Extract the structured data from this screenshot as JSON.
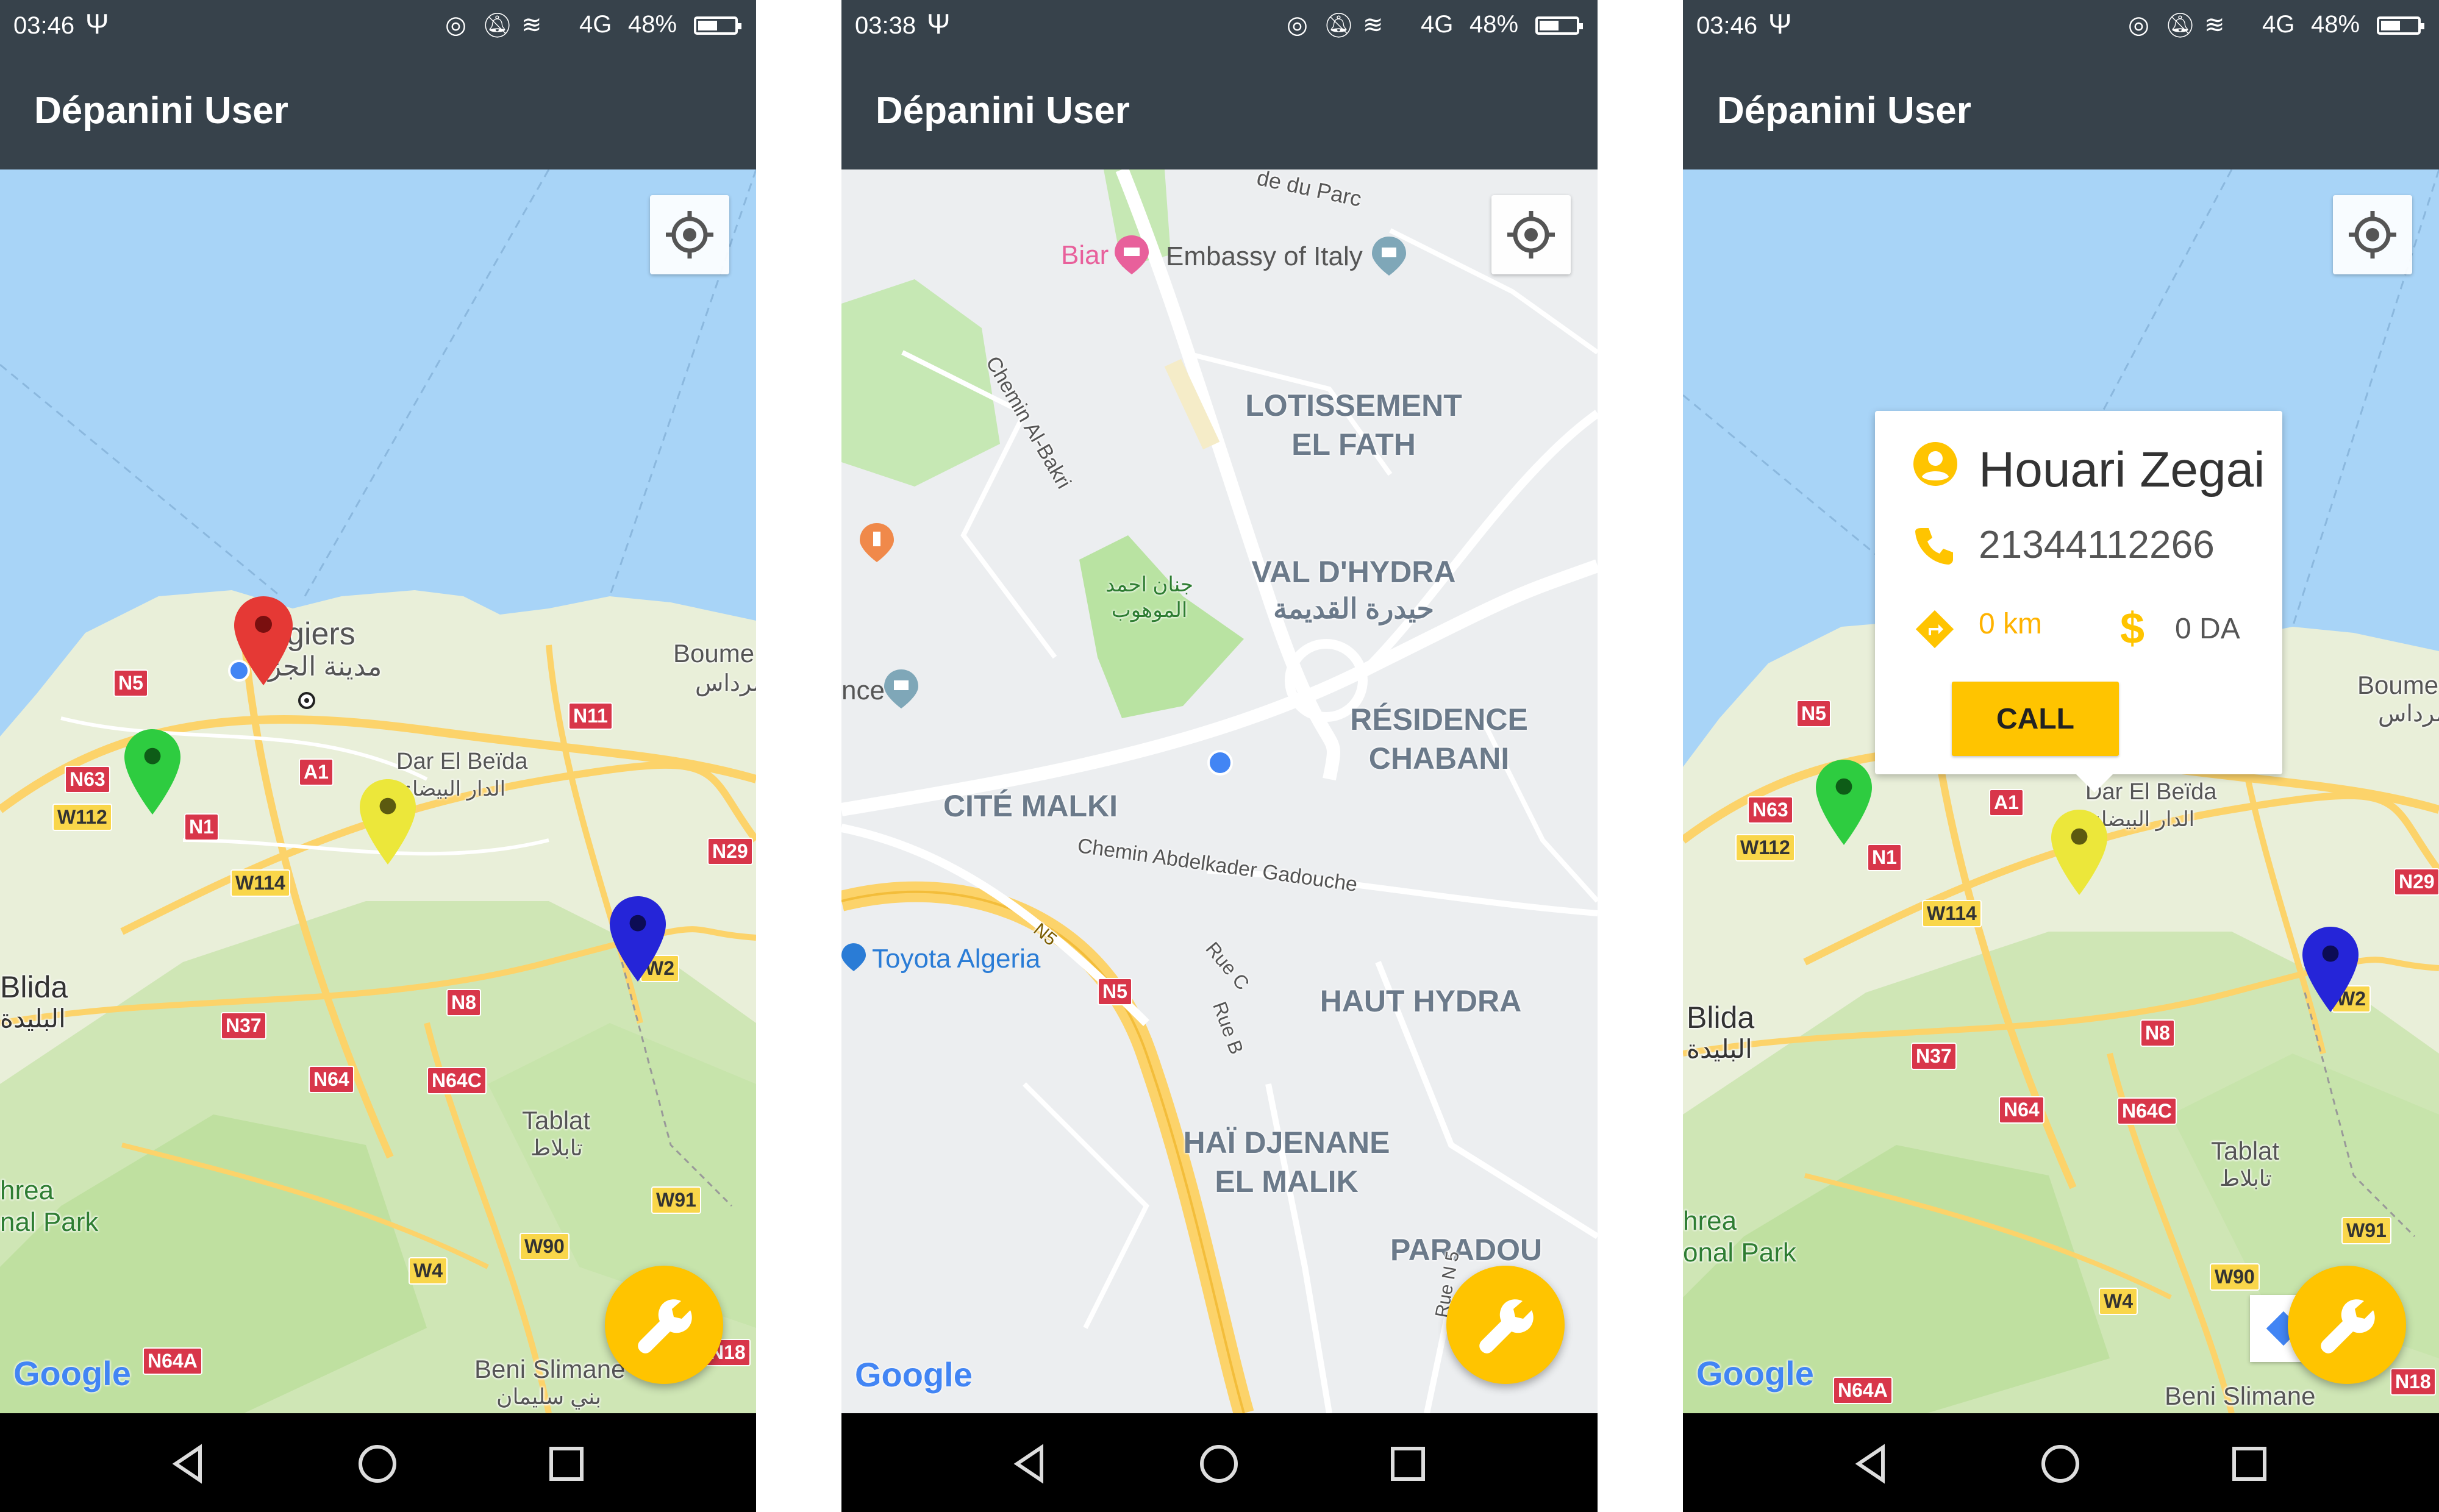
{
  "colors": {
    "appbar": "#37424b",
    "accent": "#ffc400",
    "sea": "#a8d4f7",
    "land": "#e9efd9",
    "park": "#bfe0a0",
    "road_yellow": "#fcd36a",
    "marker_red": "#e53935",
    "marker_green": "#2ecc40",
    "marker_yellow": "#ece73a",
    "marker_blue": "#2525d8"
  },
  "screens": [
    {
      "status": {
        "time": "03:46",
        "network": "4G",
        "battery": "48%"
      },
      "app_title": "Dépanini User",
      "map": {
        "labels": {
          "alger_fr": "giers",
          "alger_ar": "مدينة الجز",
          "boumerdes_fr": "Boume",
          "boumerdes_ar": "مرداس",
          "dar_el_beida_fr": "Dar El Beïda",
          "dar_el_beida_ar": "الدار البيضاء",
          "blida_fr": "Blida",
          "blida_ar": "البليدة",
          "tablat_fr": "Tablat",
          "tablat_ar": "تابلاط",
          "park1": "hrea",
          "park2": "nal Park",
          "beni_slimane_fr": "Beni Slimane",
          "beni_slimane_ar": "بني سليمان"
        },
        "shields": [
          "N5",
          "N63",
          "W112",
          "N1",
          "A1",
          "N11",
          "W114",
          "N29",
          "N8",
          "N37",
          "N64",
          "N64C",
          "W91",
          "W90",
          "W4",
          "N64A",
          "N18",
          "W2"
        ]
      },
      "google": "Google"
    },
    {
      "status": {
        "time": "03:38",
        "network": "4G",
        "battery": "48%"
      },
      "app_title": "Dépanini User",
      "map": {
        "labels": {
          "biar": "Biar",
          "embassy": "Embassy of Italy",
          "parc": "de du Parc",
          "chemin_bakri": "Chemin Al-Bakri",
          "lotissement": "LOTISSEMENT\nEL FATH",
          "val_hydra": "VAL D'HYDRA",
          "val_hydra_ar": "حيدرة القديمة",
          "jnan_ar": "جنان احمد\nالموهوب",
          "nce": "nce",
          "residence": "RÉSIDENCE\nCHABANI",
          "cite_malki": "CITÉ MALKI",
          "chemin_gadouche": "Chemin Abdelkader Gadouche",
          "toyota": "Toyota Algeria",
          "rue_c": "Rue C",
          "rue_b": "Rue B",
          "haut_hydra": "HAUT HYDRA",
          "hai_djenane": "HAÏ DJENANE\nEL MALIK",
          "paradou": "PARADOU",
          "rue_n5": "Rue N 5",
          "n5": "N5",
          "n5_curve": "N5"
        }
      },
      "google": "Google"
    },
    {
      "status": {
        "time": "03:46",
        "network": "4G",
        "battery": "48%"
      },
      "app_title": "Dépanini User",
      "info_window": {
        "name": "Houari Zegai",
        "phone": "21344112266",
        "distance": "0 km",
        "price": "0 DA",
        "call_label": "CALL"
      },
      "map": {
        "labels": {
          "boumerdes_fr": "Boume",
          "boumerdes_ar": "مرداس",
          "dar_el_beida_fr": "Dar El Beïda",
          "dar_el_beida_ar": "الدار البيضاء",
          "blida_fr": "Blida",
          "blida_ar": "البليدة",
          "tablat_fr": "Tablat",
          "tablat_ar": "تابلاط",
          "park1": "hrea",
          "park2": "onal Park",
          "beni_slimane_fr": "Beni Slimane"
        },
        "shields": [
          "N5",
          "N63",
          "W112",
          "N1",
          "A1",
          "W114",
          "N29",
          "N8",
          "N37",
          "N64",
          "N64C",
          "W91",
          "W90",
          "W4",
          "N64A",
          "N18",
          "W2"
        ]
      },
      "google": "Google"
    }
  ]
}
